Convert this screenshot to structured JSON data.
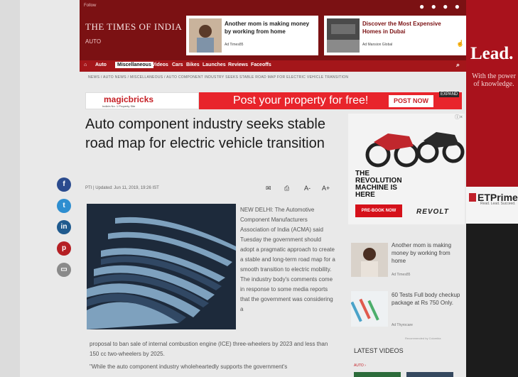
{
  "header": {
    "topbar": "Follow",
    "masthead": "THE TIMES OF INDIA",
    "section": "AUTO",
    "promos": [
      {
        "title": "Another mom is making money by working from home",
        "source": "Ad Times85"
      },
      {
        "title": "Discover the Most Expensive Homes in Dubai",
        "source": "Ad Mansion Global"
      }
    ]
  },
  "nav": {
    "home_icon": "home-icon",
    "items": [
      "Auto",
      "Miscellaneous",
      "Videos",
      "Cars",
      "Bikes",
      "Launches",
      "Reviews",
      "Faceoffs"
    ]
  },
  "breadcrumb": "NEWS / AUTO NEWS / MISCELLANEOUS / AUTO COMPONENT INDUSTRY SEEKS STABLE ROAD MAP FOR ELECTRIC VEHICLE TRANSITION",
  "banner": {
    "brand": "magicbricks",
    "tagline": "India's No. 1 Property Site",
    "text": "Post your property for free!",
    "cta": "POST NOW",
    "expand": "EXPAND"
  },
  "article": {
    "headline": "Auto component industry seeks stable road map for electric vehicle transition",
    "byline": "PTI | Updated: Jun 11, 2019, 19:26 IST",
    "font_small": "A-",
    "font_large": "A+",
    "body1": "NEW DELHI: The Automotive Component Manufacturers Association of India (ACMA) said Tuesday the government should adopt a pragmatic approach to create a stable and long-term road map for a smooth transition to electric mobility. The industry body's comments come in response to some media reports that the government was considering a",
    "body2": "proposal to ban sale of internal combustion engine (ICE) three-wheelers by 2023 and less than 150 cc two-wheelers by 2025.",
    "body3": "\"While the auto component industry wholeheartedly supports the government's"
  },
  "side": {
    "lead": "Lead.",
    "lead_sub": "With the power of knowledge.",
    "etprime": "ETPrime",
    "etprime_sub": "Read. Lead. Succeed."
  },
  "revolt_ad": {
    "title": "THE REVOLUTION MACHINE IS HERE",
    "cta": "PRE-BOOK NOW",
    "brand": "REVOLT"
  },
  "recommended": [
    {
      "title": "Another mom is making money by working from home",
      "source": "Ad Times85"
    },
    {
      "title": "60 Tests Full body checkup package at Rs 750 Only.",
      "source": "Ad Thyrocare"
    }
  ],
  "recommended_by": "Recommended by Colombia",
  "latest_videos": {
    "title": "LATEST VIDEOS",
    "category": "AUTO ›"
  },
  "colors": {
    "brand_red": "#a4161a",
    "header_dark": "#7b1113",
    "banner_red": "#e8242b"
  }
}
